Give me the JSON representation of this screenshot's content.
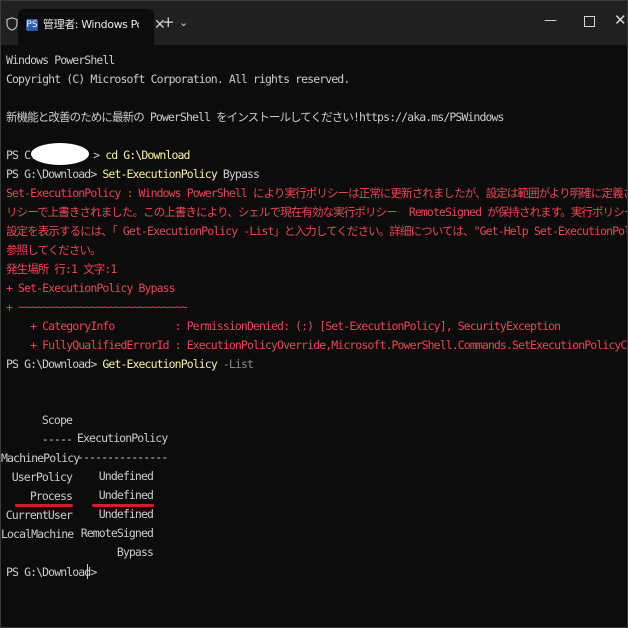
{
  "window": {
    "tab_title": "管理者: Windows PowerShell",
    "tab_icon": "PS",
    "close_tab": "✕",
    "new_tab": "+",
    "dropdown": "⌄",
    "minimize": "—",
    "close": "✕"
  },
  "terminal": {
    "banner1": "Windows PowerShell",
    "banner2": "Copyright (C) Microsoft Corporation. All rights reserved.",
    "banner3": "新機能と改善のために最新の PowerShell をインストールしてください!https://aka.ms/PSWindows",
    "prompt1": "PS C:",
    "cmd1": "cd G:\\Download",
    "prompt2": "PS G:\\Download>",
    "cmd2": "Set-ExecutionPolicy",
    "cmd2_arg": "Bypass",
    "error_lines": [
      "Set-ExecutionPolicy : Windows PowerShell により実行ポリシーは正常に更新されましたが、設定は範囲がより明確に定義されたポ",
      "リシーで上書きされました。この上書きにより、シェルで現在有効な実行ポリシー  RemoteSigned が保持されます。実行ポリシーの",
      "設定を表示するには、「 Get-ExecutionPolicy -List」と入力してください。詳細については、\"Get-Help Set-ExecutionPolicy\" を",
      "参照してください。",
      "発生場所 行:1 文字:1",
      "+ Set-ExecutionPolicy Bypass",
      "+ ~~~~~~~~~~~~~~~~~~~~~~~~~~~~",
      "    + CategoryInfo          : PermissionDenied: (:) [Set-ExecutionPolicy], SecurityException",
      "    + FullyQualifiedErrorId : ExecutionPolicyOverride,Microsoft.PowerShell.Commands.SetExecutionPolicyCommand"
    ],
    "prompt3": "PS G:\\Download>",
    "cmd3": "Get-ExecutionPolicy",
    "cmd3_arg": "-List",
    "table": {
      "headers": [
        "Scope",
        "ExecutionPolicy"
      ],
      "separators": [
        "-----",
        "---------------"
      ],
      "rows": [
        [
          "MachinePolicy",
          "Undefined"
        ],
        [
          "UserPolicy",
          "Undefined"
        ],
        [
          "Process",
          "Undefined"
        ],
        [
          "CurrentUser",
          "RemoteSigned"
        ],
        [
          "LocalMachine",
          "Bypass"
        ]
      ]
    },
    "prompt4": "PS G:\\Download>"
  },
  "colors": {
    "background": "#0c0c0c",
    "foreground": "#cccccc",
    "command": "#f9f1a5",
    "parameter": "#8a8a8a",
    "error": "#e74856",
    "annotation": "#d01f2a"
  }
}
